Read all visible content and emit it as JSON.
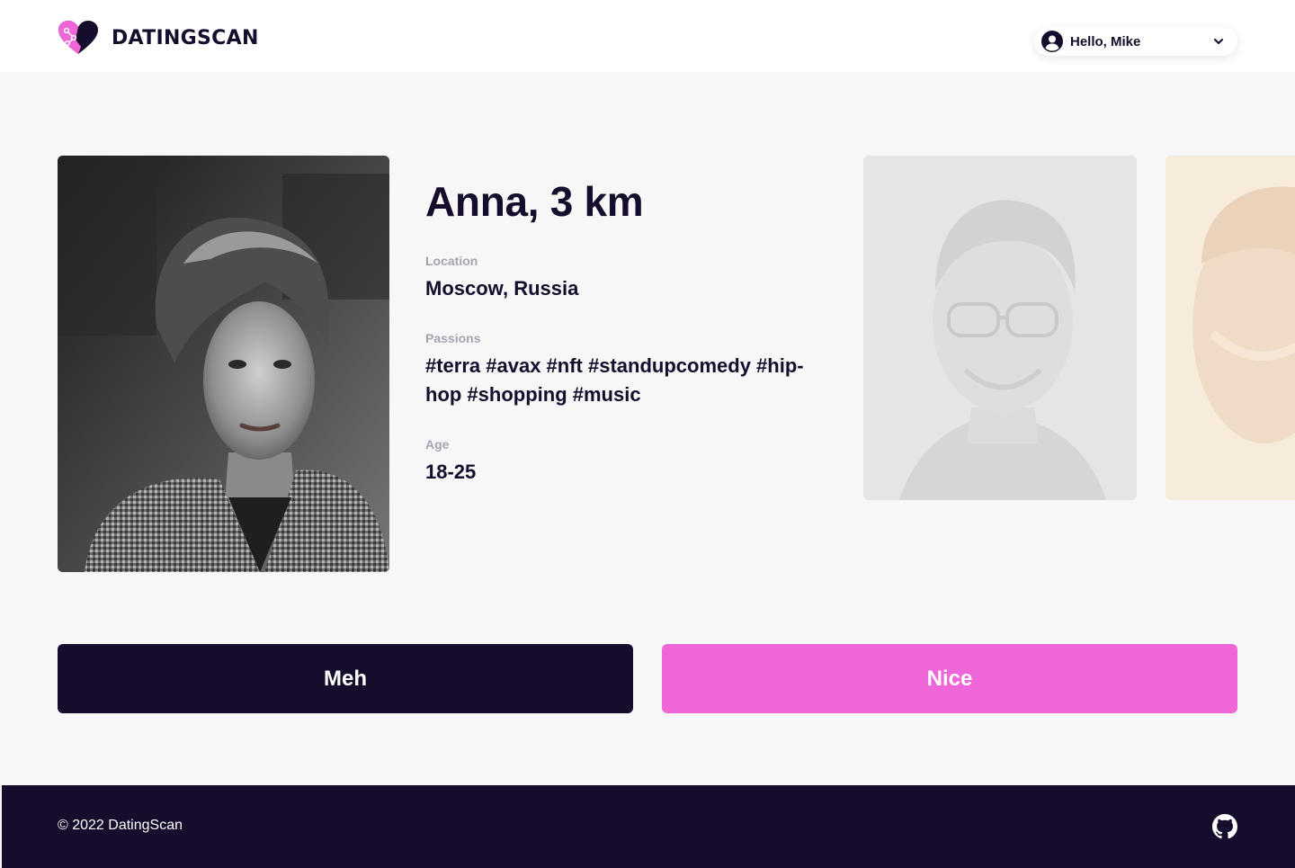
{
  "brand": {
    "name": "DATINGSCAN",
    "logo_icon": "heart-logo-icon",
    "accent_color": "#ee66d8",
    "dark_color": "#160d2d"
  },
  "user_menu": {
    "greeting": "Hello, Mike",
    "avatar_icon": "user-circle-icon",
    "dropdown_icon": "chevron-down-icon"
  },
  "profile": {
    "name_distance": "Anna, 3 km",
    "location_label": "Location",
    "location": "Moscow, Russia",
    "passions_label": "Passions",
    "passions": "#terra #avax #nft #standupcomedy #hip-hop #shopping #music",
    "age_label": "Age",
    "age": "18-25"
  },
  "actions": {
    "meh_label": "Meh",
    "nice_label": "Nice"
  },
  "footer": {
    "copyright": "© 2022 DatingScan",
    "github_icon": "github-icon"
  }
}
